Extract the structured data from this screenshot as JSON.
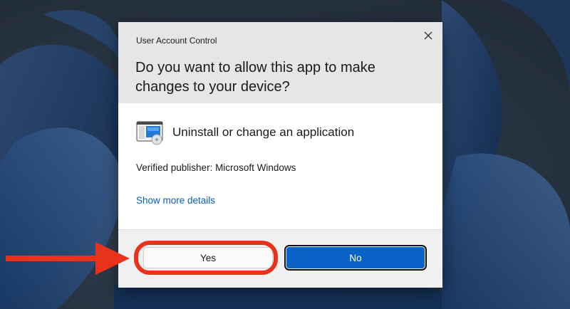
{
  "dialog": {
    "title": "User Account Control",
    "question": "Do you want to allow this app to make changes to your device?",
    "app_name": "Uninstall or change an application",
    "publisher": "Verified publisher: Microsoft Windows",
    "more_details": "Show more details",
    "yes_label": "Yes",
    "no_label": "No"
  },
  "icons": {
    "close": "close-icon",
    "app": "control-panel-icon",
    "annotation_arrow": "arrow-right-icon"
  },
  "colors": {
    "accent": "#0a64c8",
    "link": "#0a5dbf",
    "annotation": "#e8321c",
    "header_bg": "#e6e6e6"
  }
}
